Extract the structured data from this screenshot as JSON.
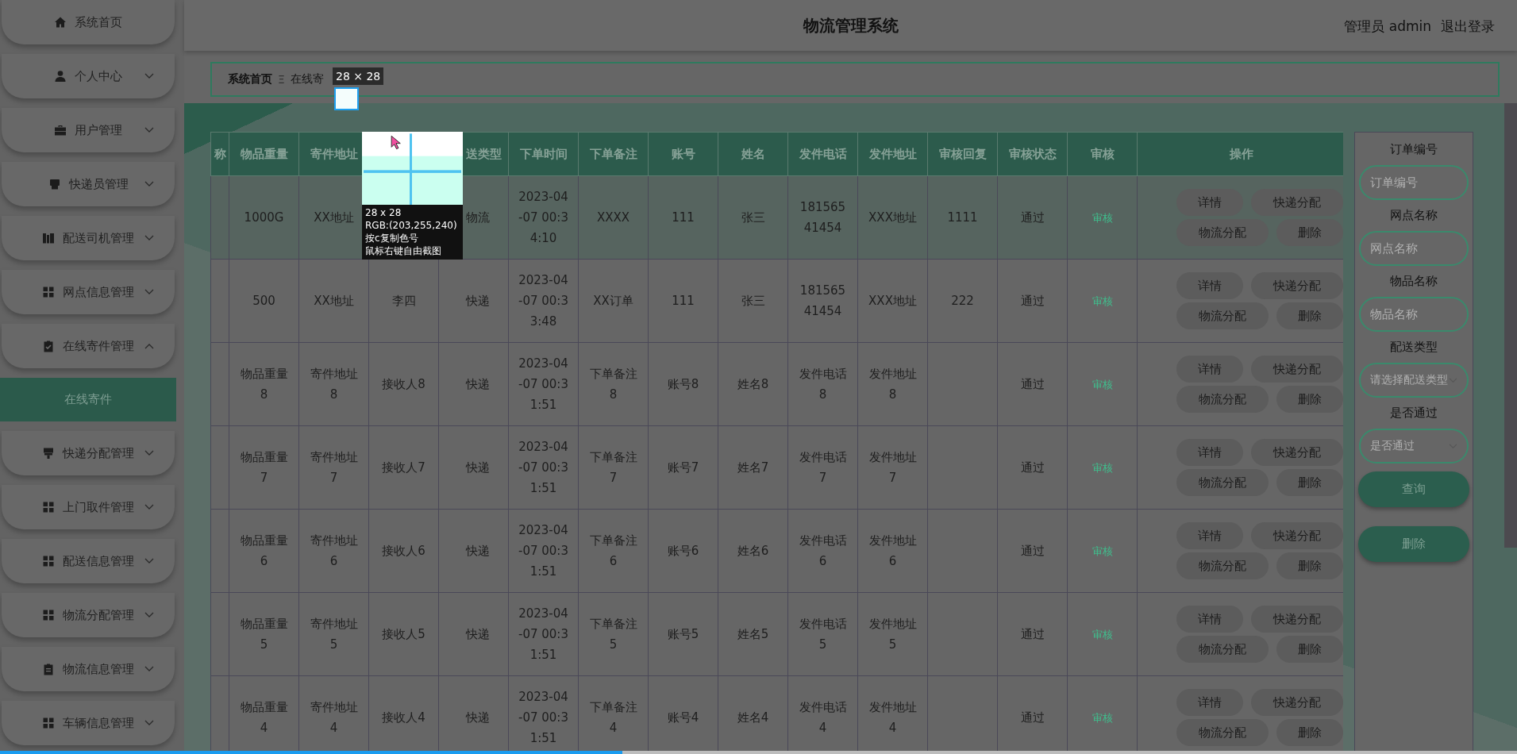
{
  "header": {
    "title": "物流管理系统",
    "user": "管理员 admin",
    "logout": "退出登录"
  },
  "sidebar": {
    "items": [
      {
        "label": "系统首页"
      },
      {
        "label": "个人中心",
        "expanded": false
      },
      {
        "label": "用户管理",
        "expanded": false
      },
      {
        "label": "快递员管理",
        "expanded": false
      },
      {
        "label": "配送司机管理",
        "expanded": false
      },
      {
        "label": "网点信息管理",
        "expanded": false
      },
      {
        "label": "在线寄件管理",
        "expanded": true,
        "children": [
          {
            "label": "在线寄件",
            "selected": true
          }
        ]
      },
      {
        "label": "快递分配管理",
        "expanded": false
      },
      {
        "label": "上门取件管理",
        "expanded": false
      },
      {
        "label": "配送信息管理",
        "expanded": false
      },
      {
        "label": "物流分配管理",
        "expanded": false
      },
      {
        "label": "物流信息管理",
        "expanded": false
      },
      {
        "label": "车辆信息管理",
        "expanded": false
      }
    ]
  },
  "breadcrumb": {
    "home": "系统首页",
    "separator": "Ξ",
    "current": "在线寄"
  },
  "table": {
    "columns": [
      "称",
      "物品重量",
      "寄件地址",
      null,
      "送类型",
      "下单时间",
      "下单备注",
      "账号",
      "姓名",
      "发件电话",
      "发件地址",
      "审核回复",
      "审核状态",
      "审核",
      "操作"
    ],
    "rows": [
      {
        "highlighted": true,
        "cells": [
          null,
          "1000G",
          "XX地址",
          null,
          "物流",
          "2023-04-07 00:34:10",
          "XXXX",
          "111",
          "张三",
          "18156541454",
          "XXX地址",
          "1111",
          "通过"
        ],
        "review": "审核",
        "actions": [
          "详情",
          "快递分配",
          "物流分配",
          "删除"
        ]
      },
      {
        "highlighted": false,
        "cells": [
          null,
          "500",
          "XX地址",
          "李四",
          "快递",
          "2023-04-07 00:33:48",
          "XX订单",
          "111",
          "张三",
          "18156541454",
          "XXX地址",
          "222",
          "通过"
        ],
        "review": "审核",
        "actions": [
          "详情",
          "快递分配",
          "物流分配",
          "删除"
        ]
      },
      {
        "highlighted": false,
        "cells": [
          null,
          "物品重量8",
          "寄件地址8",
          "接收人8",
          "快递",
          "2023-04-07 00:31:51",
          "下单备注8",
          "账号8",
          "姓名8",
          "发件电话8",
          "发件地址8",
          null,
          "通过"
        ],
        "review": "审核",
        "actions": [
          "详情",
          "快递分配",
          "物流分配",
          "删除"
        ]
      },
      {
        "highlighted": false,
        "cells": [
          null,
          "物品重量7",
          "寄件地址7",
          "接收人7",
          "快递",
          "2023-04-07 00:31:51",
          "下单备注7",
          "账号7",
          "姓名7",
          "发件电话7",
          "发件地址7",
          null,
          "通过"
        ],
        "review": "审核",
        "actions": [
          "详情",
          "快递分配",
          "物流分配",
          "删除"
        ]
      },
      {
        "highlighted": false,
        "cells": [
          null,
          "物品重量6",
          "寄件地址6",
          "接收人6",
          "快递",
          "2023-04-07 00:31:51",
          "下单备注6",
          "账号6",
          "姓名6",
          "发件电话6",
          "发件地址6",
          null,
          "通过"
        ],
        "review": "审核",
        "actions": [
          "详情",
          "快递分配",
          "物流分配",
          "删除"
        ]
      },
      {
        "highlighted": false,
        "cells": [
          null,
          "物品重量5",
          "寄件地址5",
          "接收人5",
          "快递",
          "2023-04-07 00:31:51",
          "下单备注5",
          "账号5",
          "姓名5",
          "发件电话5",
          "发件地址5",
          null,
          "通过"
        ],
        "review": "审核",
        "actions": [
          "详情",
          "快递分配",
          "物流分配",
          "删除"
        ]
      },
      {
        "highlighted": false,
        "cells": [
          null,
          "物品重量4",
          "寄件地址4",
          "接收人4",
          "快递",
          "2023-04-07 00:31:51",
          "下单备注4",
          "账号4",
          "姓名4",
          "发件电话4",
          "发件地址4",
          null,
          "通过"
        ],
        "review": "审核",
        "actions": [
          "详情",
          "快递分配",
          "物流分配",
          "删除"
        ]
      }
    ]
  },
  "search": {
    "fields": [
      {
        "kind": "input",
        "label": "订单编号",
        "placeholder": "订单编号"
      },
      {
        "kind": "input",
        "label": "网点名称",
        "placeholder": "网点名称"
      },
      {
        "kind": "input",
        "label": "物品名称",
        "placeholder": "物品名称"
      },
      {
        "kind": "select",
        "label": "配送类型",
        "placeholder": "请选择配送类型"
      },
      {
        "kind": "select",
        "label": "是否通过",
        "placeholder": "是否通过"
      }
    ],
    "buttons": [
      "查询",
      "删除"
    ]
  },
  "capture_tool": {
    "size_tip": "28 × 28",
    "info": [
      "28 x 28",
      "RGB:(203,255,240)",
      "按c复制色号",
      "鼠标右键自由截图"
    ]
  },
  "video_progress": {
    "level": 0.41
  }
}
